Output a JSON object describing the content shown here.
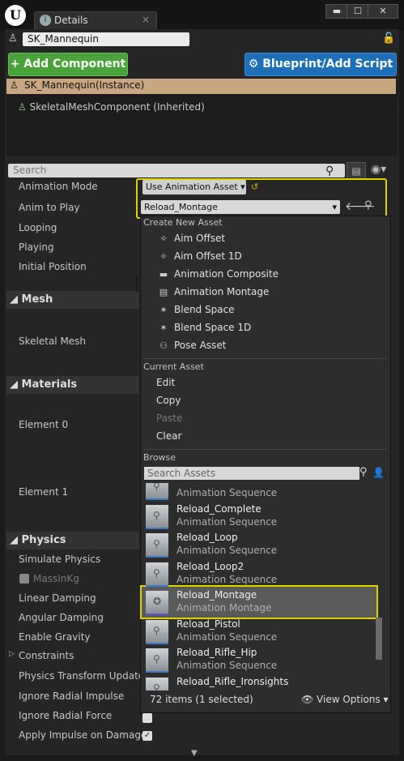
{
  "window": {
    "tab_title": "Details",
    "tab_close": "×",
    "minimize": "▬",
    "maximize": "☐",
    "close": "✕",
    "logo": "U"
  },
  "actor": {
    "name": "SK_Mannequin",
    "lock_icon": "🔓"
  },
  "toolbar": {
    "add_component": "+ Add Component ▾",
    "blueprint": "⚙ Blueprint/Add Script"
  },
  "tree": {
    "selected": "SK_Mannequin(Instance)",
    "child": "SkeletalMeshComponent (Inherited)"
  },
  "search": {
    "placeholder": "Search"
  },
  "properties": {
    "animation_mode": "Animation Mode",
    "anim_to_play": "Anim to Play",
    "looping": "Looping",
    "playing": "Playing",
    "initial_position": "Initial Position",
    "section_mesh": "Mesh",
    "skeletal_mesh": "Skeletal Mesh",
    "section_materials": "Materials",
    "element0": "Element 0",
    "element1": "Element 1",
    "section_physics": "Physics",
    "simulate_physics": "Simulate Physics",
    "mass_in_kg": "MassInKg",
    "linear_damping": "Linear Damping",
    "angular_damping": "Angular Damping",
    "enable_gravity": "Enable Gravity",
    "constraints": "Constraints",
    "physics_transform": "Physics Transform Update M",
    "ignore_radial_impulse": "Ignore Radial Impulse",
    "ignore_radial_force": "Ignore Radial Force",
    "apply_impulse": "Apply Impulse on Damage"
  },
  "anim_widget": {
    "mode_value": "Use Animation Asset ▾",
    "asset_value": "Reload_Montage"
  },
  "dropdown": {
    "create_new_header": "Create New Asset",
    "create_items": [
      "Aim Offset",
      "Aim Offset 1D",
      "Animation Composite",
      "Animation Montage",
      "Blend Space",
      "Blend Space 1D",
      "Pose Asset"
    ],
    "current_header": "Current Asset",
    "current_items": [
      "Edit",
      "Copy",
      "Paste",
      "Clear"
    ],
    "browse_header": "Browse",
    "search_placeholder": "Search Assets",
    "assets": [
      {
        "name": "",
        "type": "Animation Sequence"
      },
      {
        "name": "Reload_Complete",
        "type": "Animation Sequence"
      },
      {
        "name": "Reload_Loop",
        "type": "Animation Sequence"
      },
      {
        "name": "Reload_Loop2",
        "type": "Animation Sequence"
      },
      {
        "name": "Reload_Montage",
        "type": "Animation Montage"
      },
      {
        "name": "Reload_Pistol",
        "type": "Animation Sequence"
      },
      {
        "name": "Reload_Rifle_Hip",
        "type": "Animation Sequence"
      },
      {
        "name": "Reload_Rifle_Ironsights",
        "type": ""
      }
    ],
    "count": "72 items (1 selected)",
    "view_options": "👁 View Options ▾"
  },
  "colors": {
    "accent": "#e0d000",
    "add_green": "#4aa23a",
    "blueprint_blue": "#1e6fb8"
  }
}
